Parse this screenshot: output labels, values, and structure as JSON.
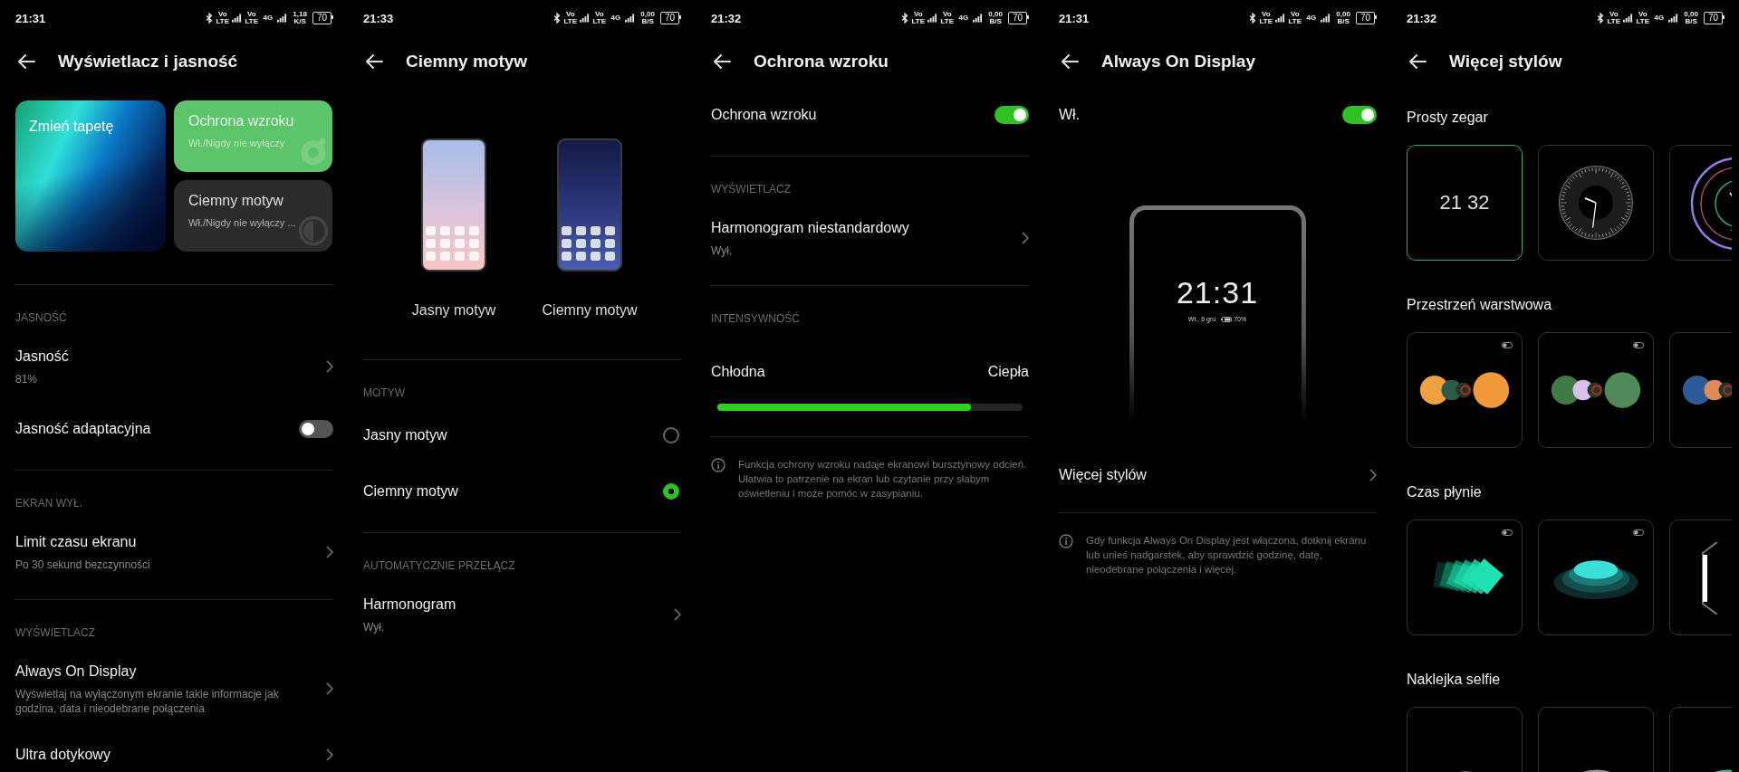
{
  "panels": [
    {
      "status_bar": {
        "time": "21:31",
        "sims": [
          {
            "labels": [
              "Vo LTE"
            ]
          },
          {
            "labels": [
              "Vo LTE",
              "4G"
            ]
          }
        ],
        "speed": "1,18",
        "speed_unit": "K/S",
        "battery": "70"
      },
      "title": "Wyświetlacz i jasność",
      "blocks": [
        {
          "kind": "quick_cards",
          "wallpaper": "Zmień tapetę",
          "tiles": [
            {
              "kind": "eye",
              "title": "Ochrona wzroku",
              "subtitle": "Wł./Nigdy nie wyłączy",
              "color": "#5cc46a"
            },
            {
              "kind": "contrast",
              "title": "Ciemny motyw",
              "subtitle": "Wł./Nigdy nie wyłączy ...",
              "color": "#2b2b2b"
            }
          ]
        },
        {
          "kind": "divider"
        },
        {
          "kind": "section",
          "title": "JASNOŚĆ"
        },
        {
          "kind": "row",
          "title": "Jasność",
          "subtitle": "81%"
        },
        {
          "kind": "toggle",
          "title": "Jasność adaptacyjna",
          "on": false
        },
        {
          "kind": "divider"
        },
        {
          "kind": "section",
          "title": "EKRAN WYŁ."
        },
        {
          "kind": "row",
          "title": "Limit czasu ekranu",
          "subtitle": "Po 30 sekund bezczynności"
        },
        {
          "kind": "divider"
        },
        {
          "kind": "section",
          "title": "WYŚWIETLACZ"
        },
        {
          "kind": "row",
          "title": "Always On Display",
          "subtitle": "Wyświetlaj na wyłączonym ekranie takie informacje jak godzina, data i nieodebrane połączenia"
        },
        {
          "kind": "row",
          "title": "Ultra dotykowy"
        }
      ]
    },
    {
      "status_bar": {
        "time": "21:33",
        "sims": [
          {
            "labels": [
              "Vo LTE"
            ]
          },
          {
            "labels": [
              "Vo LTE",
              "4G"
            ]
          }
        ],
        "speed": "0,00",
        "speed_unit": "B/S",
        "battery": "70"
      },
      "title": "Ciemny motyw",
      "blocks": [
        {
          "kind": "theme_previews",
          "items": [
            {
              "kind": "light",
              "label": "Jasny motyw"
            },
            {
              "kind": "dark",
              "label": "Ciemny motyw"
            }
          ]
        },
        {
          "kind": "divider"
        },
        {
          "kind": "section",
          "title": "MOTYW"
        },
        {
          "kind": "radio",
          "title": "Jasny motyw",
          "selected": false
        },
        {
          "kind": "radio",
          "title": "Ciemny motyw",
          "selected": true
        },
        {
          "kind": "divider"
        },
        {
          "kind": "section",
          "title": "AUTOMATYCZNIE PRZEŁĄCZ"
        },
        {
          "kind": "row",
          "title": "Harmonogram",
          "subtitle": "Wył."
        }
      ]
    },
    {
      "status_bar": {
        "time": "21:32",
        "sims": [
          {
            "labels": [
              "Vo LTE"
            ]
          },
          {
            "labels": [
              "Vo LTE",
              "4G"
            ]
          }
        ],
        "speed": "0,00",
        "speed_unit": "B/S",
        "battery": "70"
      },
      "title": "Ochrona wzroku",
      "blocks": [
        {
          "kind": "toggle",
          "title": "Ochrona wzroku",
          "on": true
        },
        {
          "kind": "divider"
        },
        {
          "kind": "section",
          "title": "WYŚWIETLACZ"
        },
        {
          "kind": "row",
          "title": "Harmonogram niestandardowy",
          "subtitle": "Wył."
        },
        {
          "kind": "divider"
        },
        {
          "kind": "section",
          "title": "INTENSYWNOŚĆ"
        },
        {
          "kind": "slider",
          "left": "Chłodna",
          "right": "Ciepła",
          "level": 0.83
        },
        {
          "kind": "divider"
        },
        {
          "kind": "info",
          "text": "Funkcja ochrony wzroku nadaje ekranowi bursztynowy odcień. Ułatwia to patrzenie na ekran lub czytanie przy słabym oświetleniu i może pomóc w zasypianiu."
        }
      ]
    },
    {
      "status_bar": {
        "time": "21:31",
        "sims": [
          {
            "labels": [
              "Vo LTE"
            ]
          },
          {
            "labels": [
              "Vo LTE",
              "4G"
            ]
          }
        ],
        "speed": "0,00",
        "speed_unit": "B/S",
        "battery": "70"
      },
      "title": "Always On Display",
      "blocks": [
        {
          "kind": "toggle",
          "title": "Wł.",
          "on": true
        },
        {
          "kind": "aod_preview",
          "time": "21:31",
          "date": "Wt., 6 gru",
          "battery": "70%"
        },
        {
          "kind": "row",
          "title": "Więcej stylów"
        },
        {
          "kind": "divider"
        },
        {
          "kind": "info",
          "text": "Gdy funkcja Always On Display jest włączona, dotknij ekranu lub unieś nadgarstek, aby sprawdzić godzinę, datę, nieodebrane połączenia i więcej."
        }
      ]
    },
    {
      "status_bar": {
        "time": "21:32",
        "sims": [
          {
            "labels": [
              "Vo LTE"
            ]
          },
          {
            "labels": [
              "Vo LTE",
              "4G"
            ]
          }
        ],
        "speed": "0,00",
        "speed_unit": "B/S",
        "battery": "70"
      },
      "title": "Więcej stylów",
      "blocks": [
        {
          "kind": "style_group",
          "title": "Prosty zegar",
          "tiles": [
            {
              "kind": "digital",
              "time": "21 32",
              "selected": true
            },
            {
              "kind": "analog",
              "selected": false
            },
            {
              "kind": "rings",
              "selected": false
            }
          ]
        },
        {
          "kind": "style_group",
          "title": "Przestrzeń warstwowa",
          "tiles": [
            {
              "kind": "orbs",
              "selected": false
            },
            {
              "kind": "orbs",
              "selected": false
            },
            {
              "kind": "orbs",
              "selected": false
            }
          ]
        },
        {
          "kind": "style_group",
          "title": "Czas płynie",
          "tiles": [
            {
              "kind": "cards",
              "selected": false
            },
            {
              "kind": "dome",
              "selected": false
            },
            {
              "kind": "light",
              "selected": false
            }
          ]
        },
        {
          "kind": "style_group",
          "title": "Naklejka selfie",
          "tiles": [
            {
              "kind": "ring",
              "selected": false
            },
            {
              "kind": "ring",
              "selected": false
            },
            {
              "kind": "ring",
              "selected": false
            }
          ]
        }
      ]
    }
  ]
}
